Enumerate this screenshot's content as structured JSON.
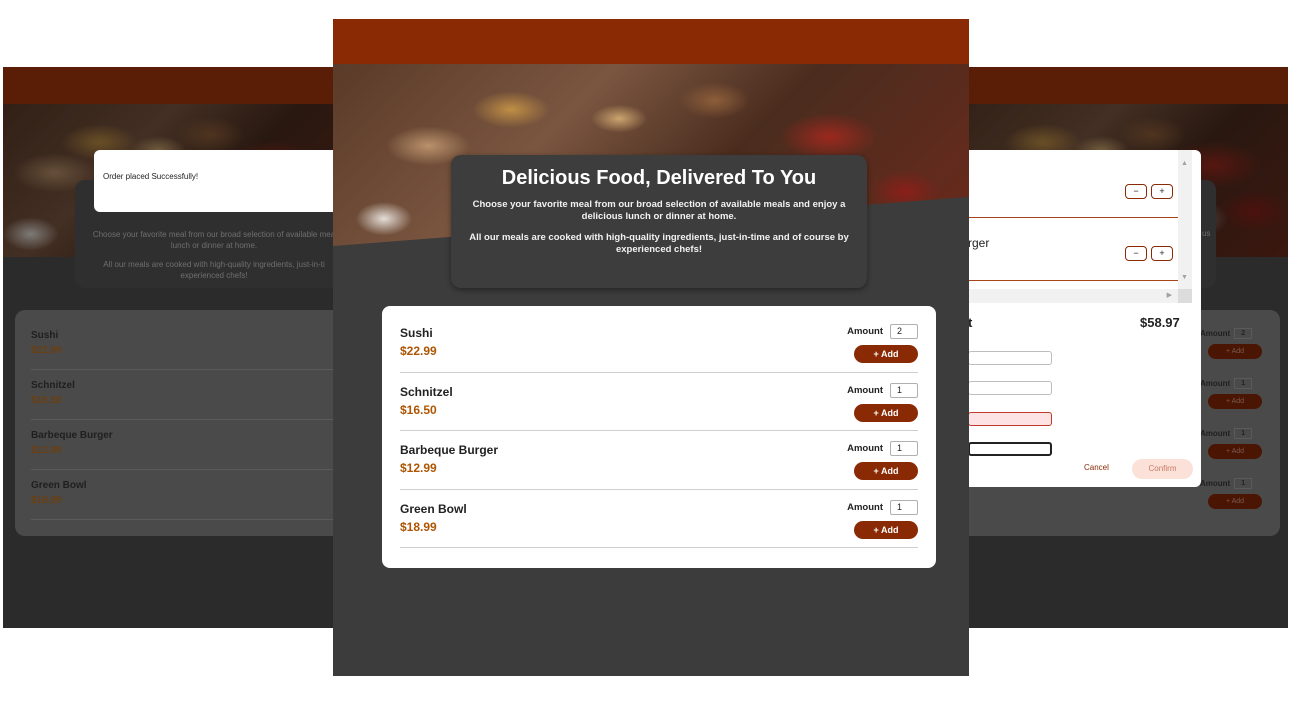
{
  "hero": {
    "title": "Delicious Food, Delivered To You",
    "para1": "Choose your favorite meal from our broad selection of available meals and enjoy a delicious lunch or dinner at home.",
    "para2": "All our meals are cooked with high-quality ingredients, just-in-time and of course by experienced chefs!"
  },
  "amount_label": "Amount",
  "add_label": "+ Add",
  "meals": [
    {
      "name": "Sushi",
      "price": "$22.99",
      "amount": "2"
    },
    {
      "name": "Schnitzel",
      "price": "$16.50",
      "amount": "1"
    },
    {
      "name": "Barbeque Burger",
      "price": "$12.99",
      "amount": "1"
    },
    {
      "name": "Green Bowl",
      "price": "$18.99",
      "amount": "1"
    }
  ],
  "left_panel": {
    "toast": "Order placed Successfully!",
    "dim1": "Choose your favorite meal from our broad selection of available mea",
    "dim1b": "lunch or dinner at home.",
    "dim2": "All our meals are cooked with high-quality ingredients, just-in-ti",
    "dim2b": "experienced chefs!"
  },
  "right_panel": {
    "dim": "us",
    "amounts": [
      "2",
      "1",
      "1",
      "1"
    ]
  },
  "cart": {
    "item2_partial": "rger",
    "minus": "−",
    "plus": "+",
    "total_label": "t",
    "total": "$58.97",
    "cancel": "Cancel",
    "confirm": "Confirm"
  },
  "colors": {
    "brand": "#8a2a05",
    "price": "#ad5502",
    "panel": "#3c3c3c"
  }
}
